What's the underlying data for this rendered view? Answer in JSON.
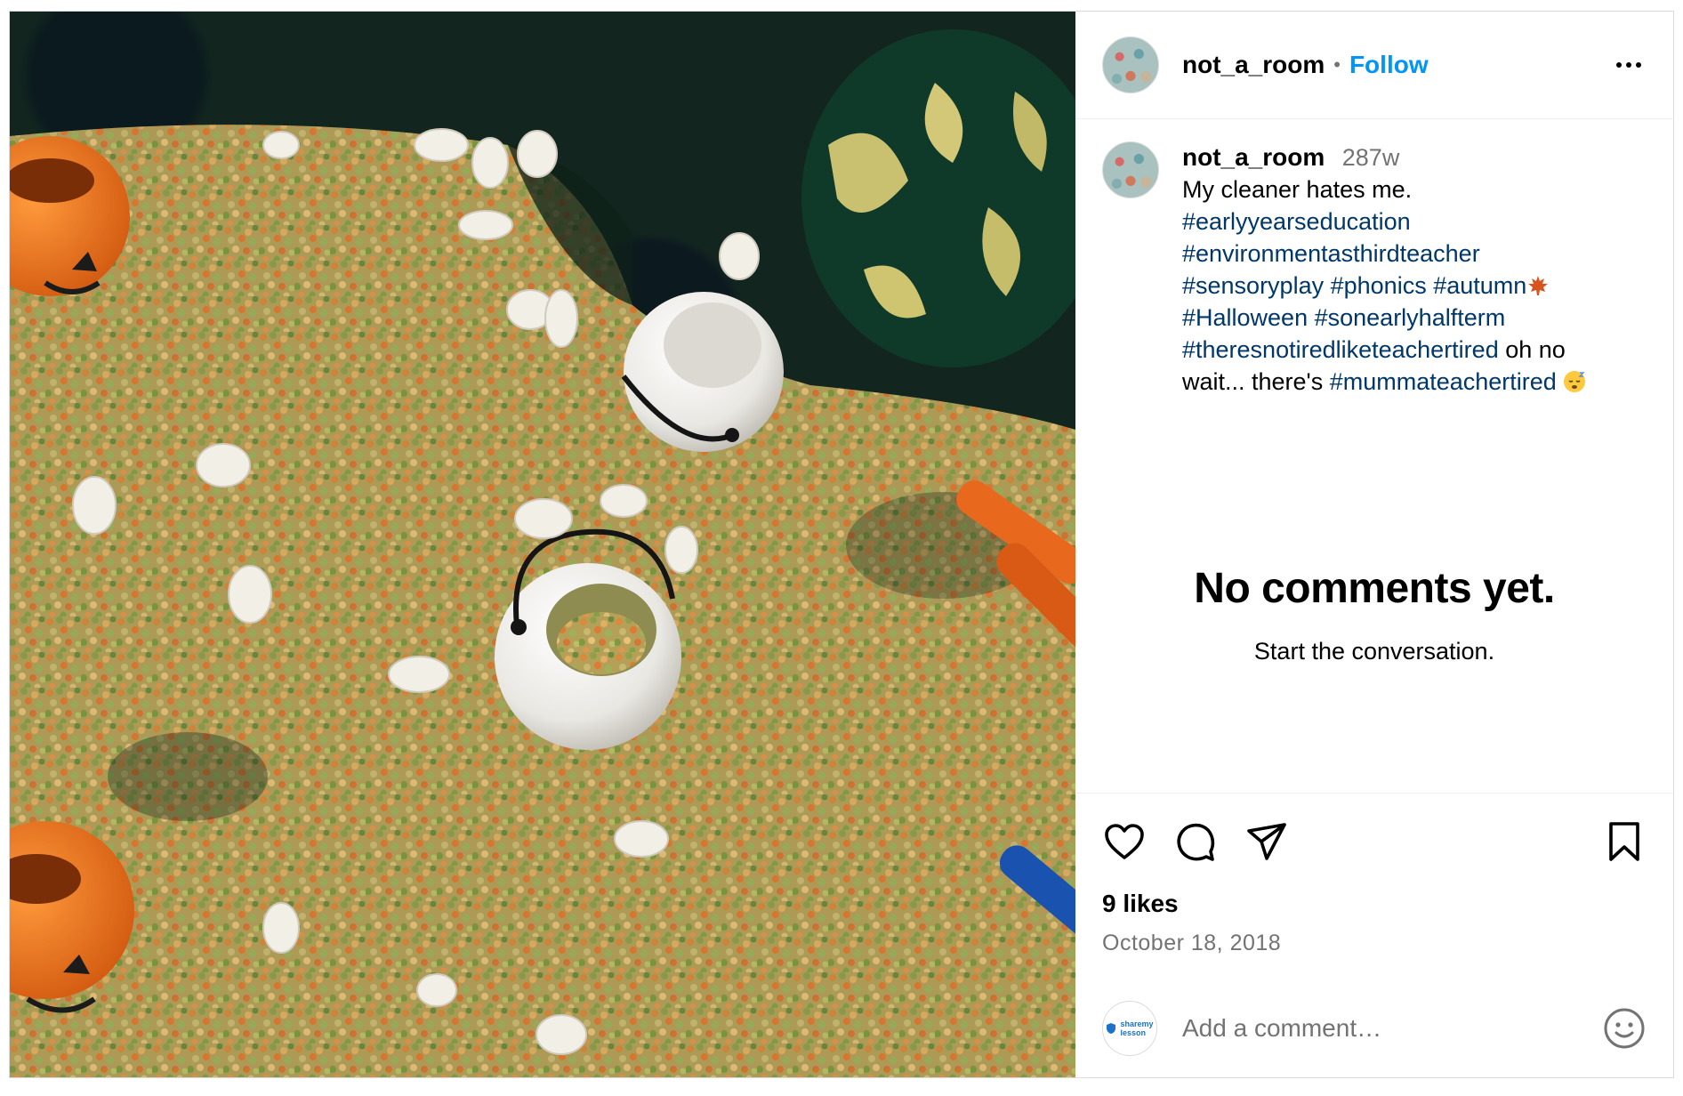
{
  "post": {
    "photo_alt": "",
    "author": {
      "username": "not_a_room",
      "separator": "•",
      "follow_label": "Follow"
    },
    "caption": {
      "username": "not_a_room",
      "age": "287w",
      "text": "My cleaner hates me.",
      "hashtags_line1": "#earlyyearseducation",
      "hashtags_line2": "#environmentasthirdteacher",
      "hashtags_line3": [
        "#sensoryplay",
        "#phonics",
        "#autumn"
      ],
      "hashtags_line4": [
        "#Halloween",
        "#sonearlyhalfterm"
      ],
      "hashtags_line5": "#theresnotiredliketeachertired",
      "text_after_tag": " oh no",
      "line6_text": "wait... there's ",
      "hashtags_line6": "#mummateachertired"
    },
    "comments": {
      "empty_title": "No comments yet.",
      "empty_subtitle": "Start the conversation."
    },
    "stats": {
      "likes": "9 likes",
      "date": "October 18, 2018"
    },
    "composer": {
      "placeholder": "Add a comment…",
      "avatar_brand_line1": "sharemy",
      "avatar_brand_line2": "lesson"
    }
  },
  "colors": {
    "follow": "#0095f6",
    "hashtag": "#00376b",
    "muted": "#737373",
    "border": "#dbdbdb"
  },
  "icons": [
    "heart-icon",
    "comment-icon",
    "share-icon",
    "bookmark-icon",
    "smiley-icon",
    "more-icon",
    "maple-leaf-icon",
    "sleepy-face-icon"
  ]
}
